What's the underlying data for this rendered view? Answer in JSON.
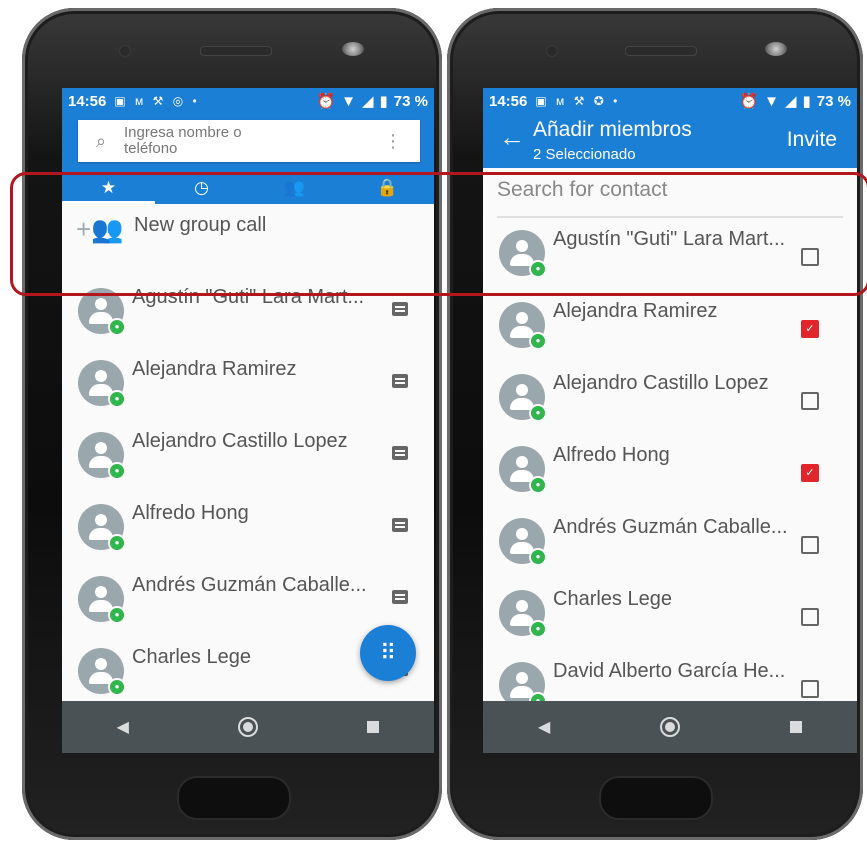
{
  "left_phone": {
    "status": {
      "time": "14:56",
      "battery": "73 %"
    },
    "search": {
      "placeholder": "Ingresa nombre o teléfono"
    },
    "tabs": [
      {
        "icon": "star-icon",
        "glyph": "★"
      },
      {
        "icon": "clock-icon",
        "glyph": "◷"
      },
      {
        "icon": "group-icon",
        "glyph": "👥"
      },
      {
        "icon": "lock-icon",
        "glyph": "🔒"
      }
    ],
    "new_group_call": "New group call",
    "contacts": [
      {
        "name": "Agustín \"Guti\" Lara Mart..."
      },
      {
        "name": "Alejandra Ramirez"
      },
      {
        "name": "Alejandro Castillo Lopez"
      },
      {
        "name": "Alfredo Hong"
      },
      {
        "name": "Andrés Guzmán Caballe..."
      },
      {
        "name": "Charles Lege"
      }
    ]
  },
  "right_phone": {
    "status": {
      "time": "14:56",
      "battery": "73 %"
    },
    "appbar": {
      "title": "Añadir miembros",
      "subtitle": "2 Seleccionado",
      "action": "Invite"
    },
    "search": {
      "placeholder": "Search for contact"
    },
    "contacts": [
      {
        "name": "Agustín \"Guti\" Lara Mart...",
        "checked": false
      },
      {
        "name": "Alejandra Ramirez",
        "checked": true
      },
      {
        "name": "Alejandro Castillo Lopez",
        "checked": false
      },
      {
        "name": "Alfredo Hong",
        "checked": true
      },
      {
        "name": "Andrés Guzmán Caballe...",
        "checked": false
      },
      {
        "name": "Charles Lege",
        "checked": false
      },
      {
        "name": "David Alberto García He...",
        "checked": false
      }
    ]
  },
  "colors": {
    "primary": "#1c7fd6",
    "checkbox_on": "#e0262b",
    "lock_badge": "#2fb64c",
    "highlight": "#b3161c"
  }
}
